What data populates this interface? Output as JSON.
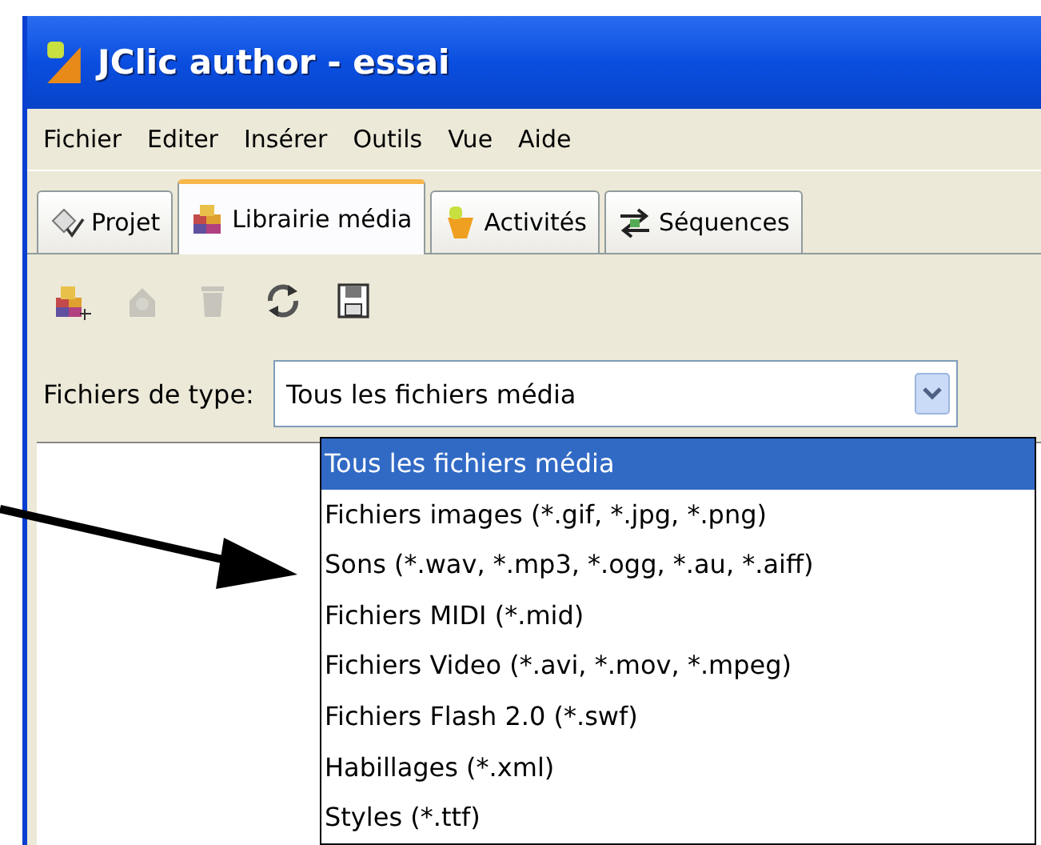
{
  "window": {
    "title": "JClic author - essai"
  },
  "menu": [
    "Fichier",
    "Editer",
    "Insérer",
    "Outils",
    "Vue",
    "Aide"
  ],
  "tabs": [
    {
      "label": "Projet",
      "selected": false,
      "kind": "project"
    },
    {
      "label": "Librairie média",
      "selected": true,
      "kind": "media"
    },
    {
      "label": "Activités",
      "selected": false,
      "kind": "activities"
    },
    {
      "label": "Séquences",
      "selected": false,
      "kind": "sequences"
    }
  ],
  "toolbar": [
    {
      "kind": "add",
      "disabled": false
    },
    {
      "kind": "view",
      "disabled": true
    },
    {
      "kind": "delete",
      "disabled": true
    },
    {
      "kind": "update",
      "disabled": false
    },
    {
      "kind": "save",
      "disabled": false
    }
  ],
  "filter": {
    "label": "Fichiers de type:",
    "value": "Tous les fichiers média",
    "options": [
      {
        "label": "Tous les fichiers média",
        "selected": true
      },
      {
        "label": "Fichiers images (*.gif, *.jpg, *.png)",
        "selected": false
      },
      {
        "label": "Sons (*.wav, *.mp3, *.ogg, *.au, *.aiff)",
        "selected": false
      },
      {
        "label": "Fichiers MIDI (*.mid)",
        "selected": false
      },
      {
        "label": "Fichiers Video (*.avi, *.mov, *.mpeg)",
        "selected": false
      },
      {
        "label": "Fichiers Flash 2.0 (*.swf)",
        "selected": false
      },
      {
        "label": "Habillages (*.xml)",
        "selected": false
      },
      {
        "label": "Styles (*.ttf)",
        "selected": false
      }
    ]
  }
}
